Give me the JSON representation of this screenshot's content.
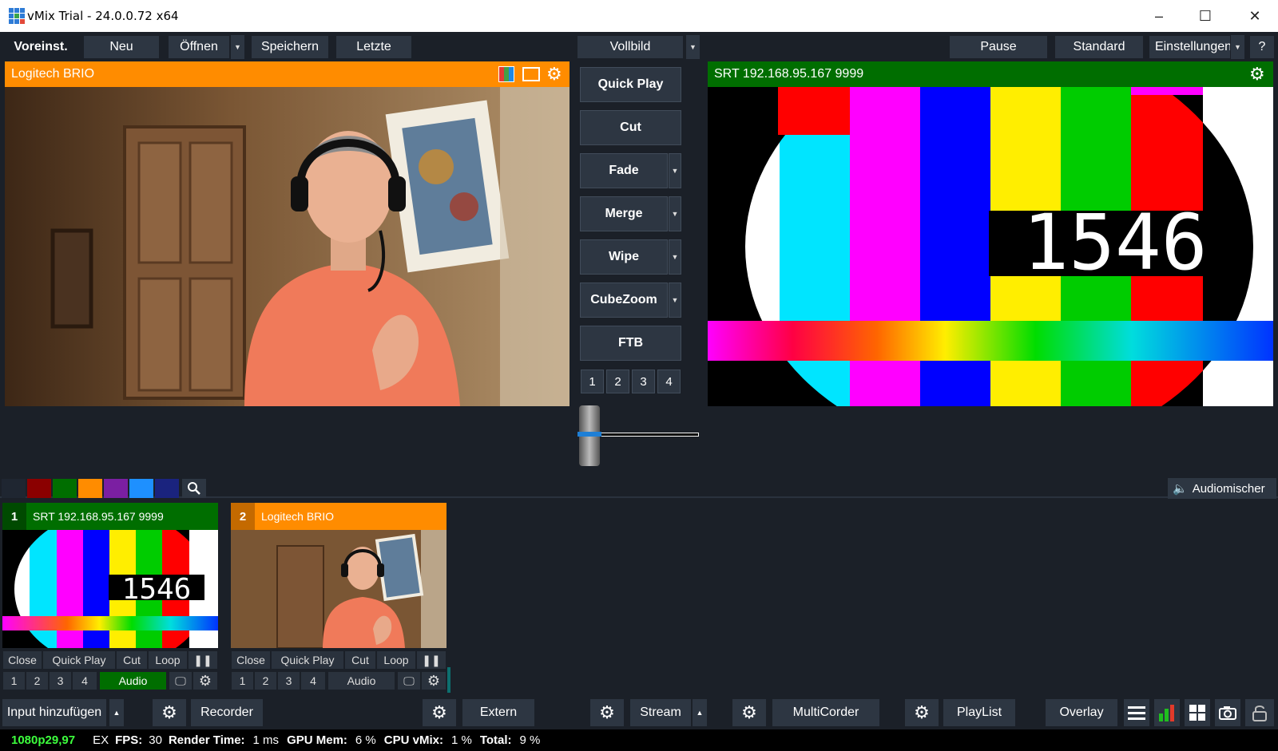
{
  "window": {
    "title": "vMix Trial - 24.0.0.72 x64",
    "minimize": "–",
    "maximize": "☐",
    "close": "✕"
  },
  "toolbar": {
    "voreinst": "Voreinst.",
    "neu": "Neu",
    "oeffnen": "Öffnen",
    "speichern": "Speichern",
    "letzte": "Letzte",
    "vollbild": "Vollbild",
    "pause": "Pause",
    "standard": "Standard",
    "einstellungen": "Einstellungen",
    "help": "?"
  },
  "preview": {
    "title": "Logitech BRIO",
    "color": "#ff8c00"
  },
  "output": {
    "title": "SRT 192.168.95.167 9999",
    "color": "#006e00",
    "clock": "1546"
  },
  "transitions": {
    "quick_play": "Quick Play",
    "cut": "Cut",
    "fade": "Fade",
    "merge": "Merge",
    "wipe": "Wipe",
    "cubezoom": "CubeZoom",
    "ftb": "FTB",
    "numbers": [
      "1",
      "2",
      "3",
      "4"
    ],
    "tbar_position": 0.0
  },
  "filters": {
    "colors": [
      "#1f2631",
      "#8b0000",
      "#006e00",
      "#ff8c00",
      "#7b1fa2",
      "#1e90ff",
      "#1a237e"
    ],
    "audiomixer_label": "Audiomischer"
  },
  "inputs": [
    {
      "number": "1",
      "name": "SRT 192.168.95.167 9999",
      "color": "#006e00",
      "clock": "1546",
      "buttons": {
        "close": "Close",
        "quick_play": "Quick Play",
        "cut": "Cut",
        "loop": "Loop",
        "pause": "❚❚"
      },
      "overlays": [
        "1",
        "2",
        "3",
        "4"
      ],
      "audio": "Audio",
      "audio_active": true
    },
    {
      "number": "2",
      "name": "Logitech BRIO",
      "color": "#ff8c00",
      "buttons": {
        "close": "Close",
        "quick_play": "Quick Play",
        "cut": "Cut",
        "loop": "Loop",
        "pause": "❚❚"
      },
      "overlays": [
        "1",
        "2",
        "3",
        "4"
      ],
      "audio": "Audio",
      "audio_active": false
    }
  ],
  "bottombar": {
    "input_hinzufuegen": "Input hinzufügen",
    "recorder": "Recorder",
    "extern": "Extern",
    "stream": "Stream",
    "multicorder": "MultiCorder",
    "playlist": "PlayList",
    "overlay": "Overlay"
  },
  "status": {
    "format": "1080p29,97",
    "ex": "EX",
    "fps_label": "FPS:",
    "fps": "30",
    "render_label": "Render Time:",
    "render": "1 ms",
    "gpu_label": "GPU Mem:",
    "gpu": "6 %",
    "cpu_label": "CPU vMix:",
    "cpu": "1 %",
    "total_label": "Total:",
    "total": "9 %"
  },
  "icons": [
    "gear-icon",
    "search-icon",
    "speaker-icon",
    "menu-icon",
    "bars-icon",
    "grid-icon",
    "camera-icon",
    "lock-icon",
    "monitor-icon"
  ]
}
